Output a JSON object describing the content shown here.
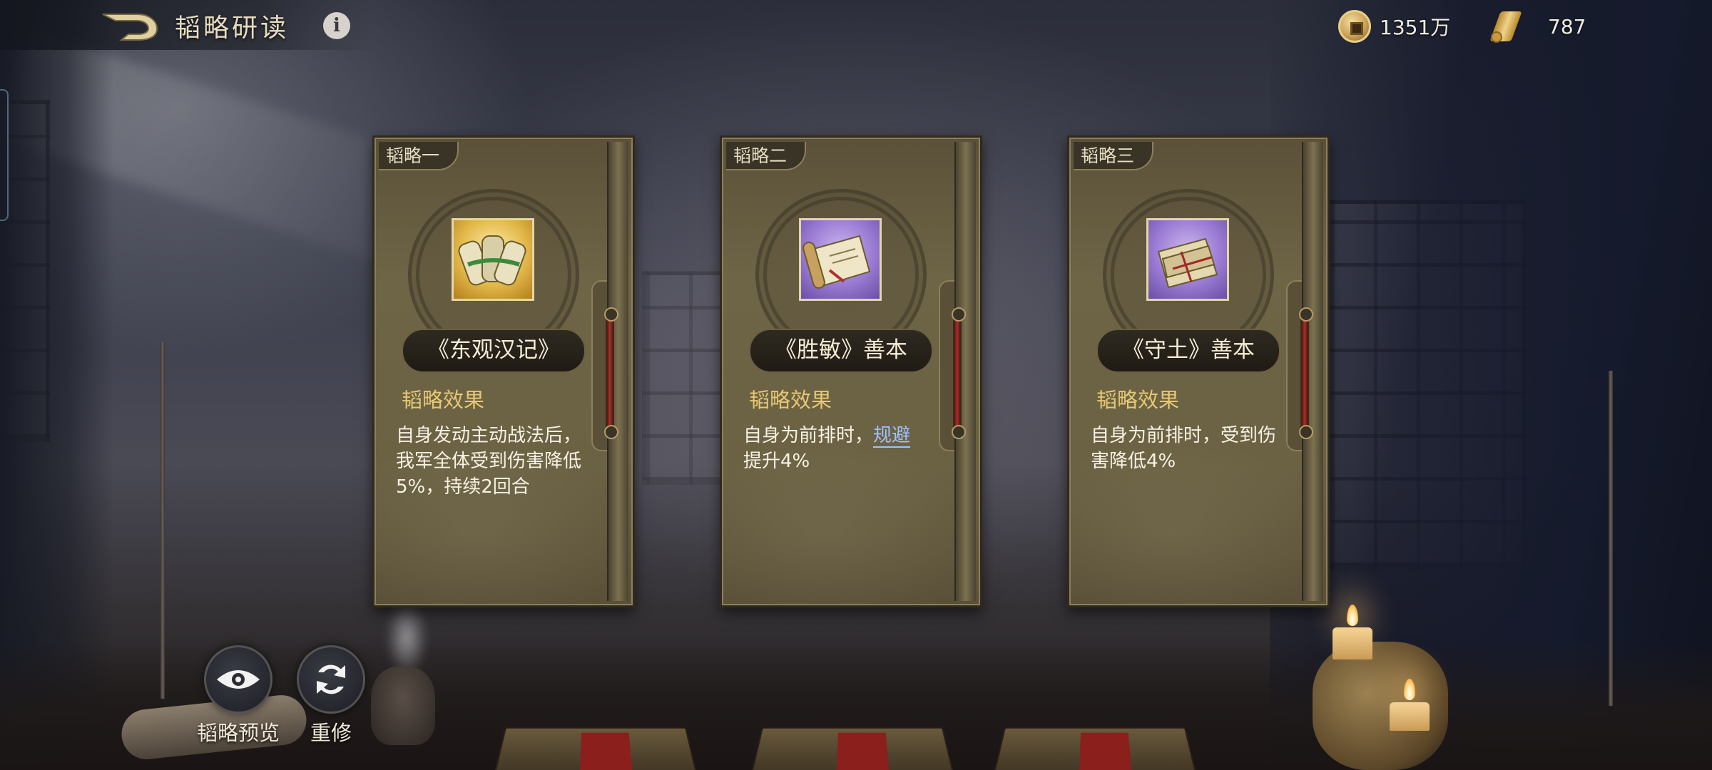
{
  "header": {
    "title": "韬略研读",
    "info_glyph": "i",
    "back_icon": "back-arrow-icon"
  },
  "currencies": [
    {
      "icon": "copper-coin-icon",
      "value": "1351万"
    },
    {
      "icon": "golden-scroll-icon",
      "value": "787"
    }
  ],
  "cards": [
    {
      "tag": "韬略一",
      "item_color": "gold",
      "name": "《东观汉记》",
      "effect_label": "韬略效果",
      "effect_text": "自身发动主动战法后，我军全体受到伤害降低5%，持续2回合"
    },
    {
      "tag": "韬略二",
      "item_color": "purple",
      "name": "《胜敏》善本",
      "effect_label": "韬略效果",
      "effect_before": "自身为前排时，",
      "effect_keyword": "规避",
      "effect_after": "提升4%"
    },
    {
      "tag": "韬略三",
      "item_color": "purple",
      "name": "《守土》善本",
      "effect_label": "韬略效果",
      "effect_text": "自身为前排时，受到伤害降低4%"
    }
  ],
  "bottom_buttons": [
    {
      "icon": "eye-icon",
      "label": "韬略预览"
    },
    {
      "icon": "refresh-icon",
      "label": "重修"
    }
  ],
  "colors": {
    "gold_text": "#e6c873",
    "keyword_blue": "#9fc1ff",
    "card_bg": "#6b6244"
  }
}
